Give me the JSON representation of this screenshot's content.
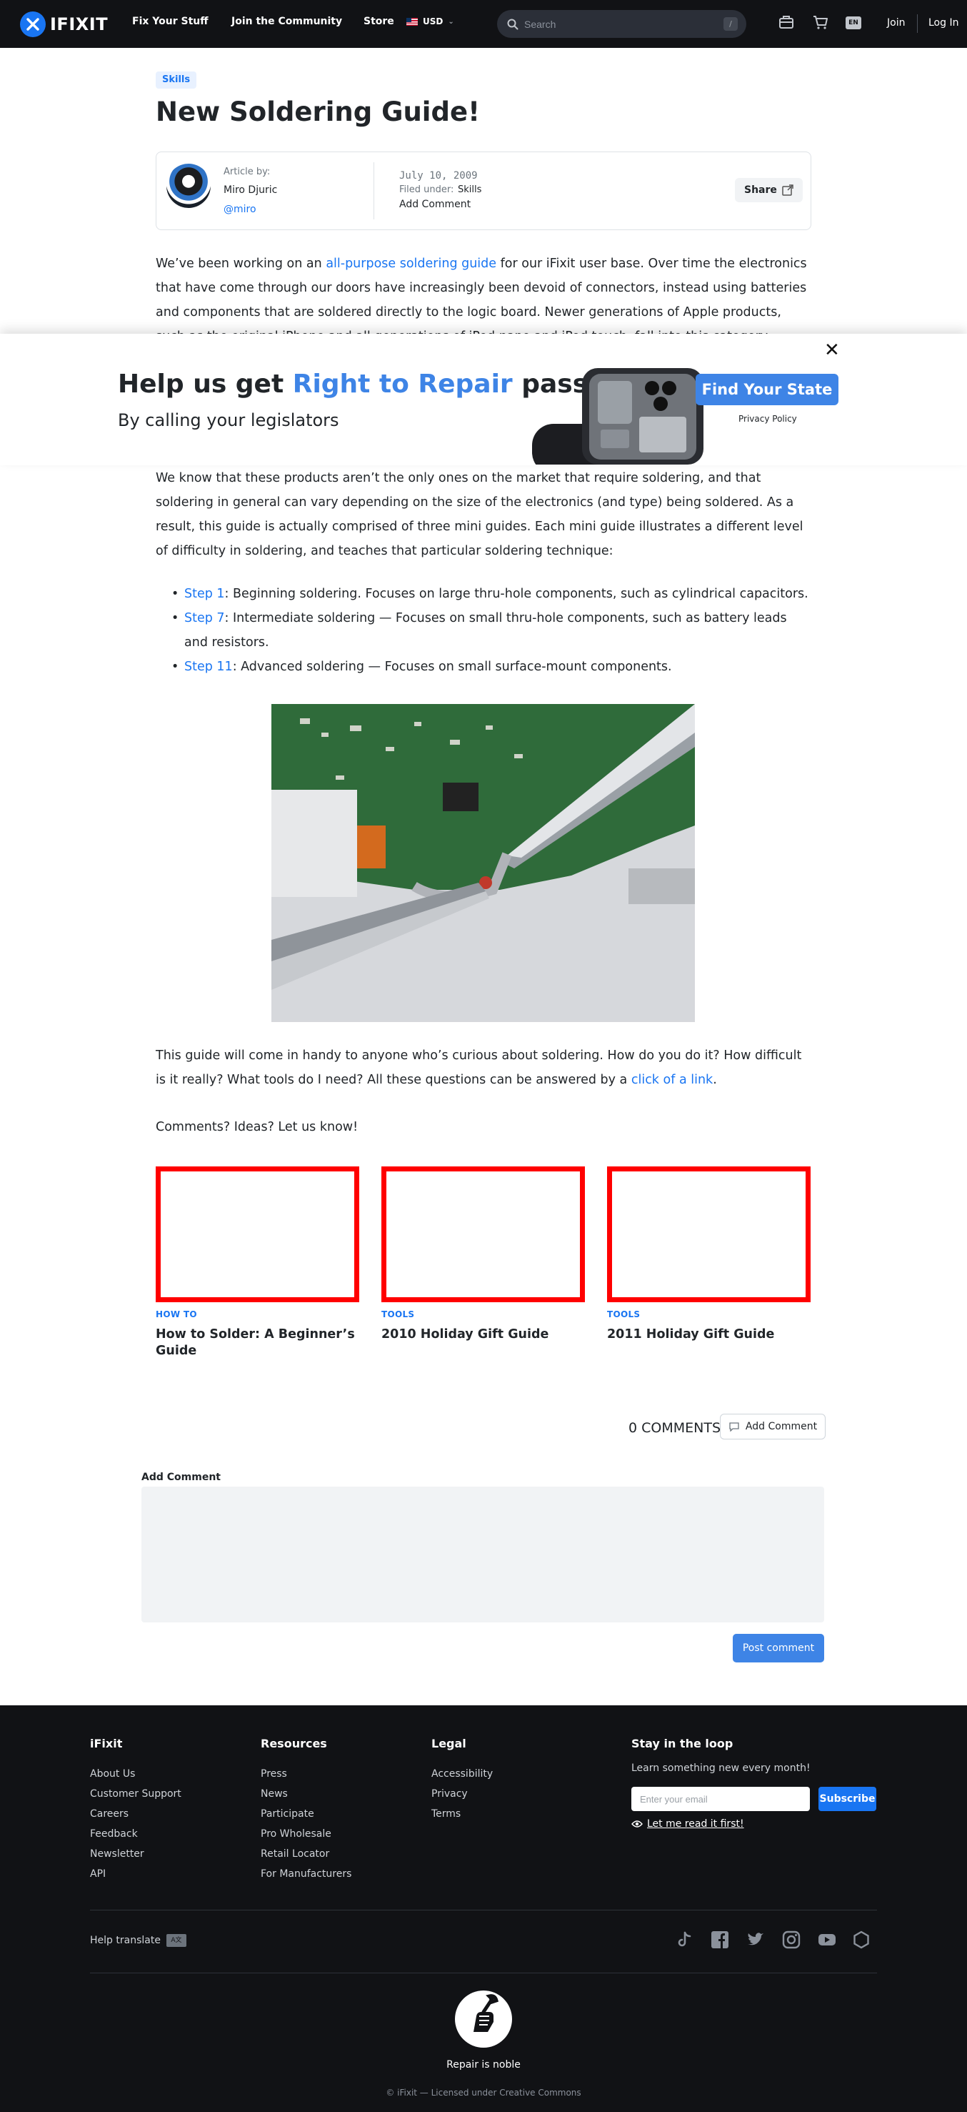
{
  "header": {
    "logo_text": "IFIXIT",
    "nav": [
      "Fix Your Stuff",
      "Join the Community",
      "Store"
    ],
    "currency": "USD",
    "search_placeholder": "Search",
    "search_shortcut": "/",
    "language_badge": "EN",
    "join": "Join",
    "login": "Log In"
  },
  "article": {
    "tag": "Skills",
    "title": "New Soldering Guide!",
    "author_label": "Article by:",
    "author_name": "Miro Djuric",
    "author_handle": "@miro",
    "date": "July 10, 2009",
    "filed_label": "Filed under:",
    "filed_value": "Skills",
    "add_comment": "Add Comment",
    "share": "Share",
    "intro_pre": "We’ve been working on an ",
    "intro_link": "all-purpose soldering guide",
    "intro_post": " for our iFixit user base. Over time the electronics that have come through our doors have increasingly been devoid of connectors, instead using batteries and components that are soldered directly to the logic board. Newer generations of Apple products, such as the original iPhone and all generations of iPod nano and iPod touch, fall into this category.",
    "para2": "We know that these products aren’t the only ones on the market that require soldering, and that soldering in general can vary depending on the size of the electronics (and type) being soldered. As a result, this guide is actually comprised of three mini guides. Each mini guide illustrates a different level of difficulty in soldering, and teaches that particular soldering technique:",
    "steps": [
      {
        "link": "Step 1",
        "text": ": Beginning soldering. Focuses on large thru-hole components, such as cylindrical capacitors."
      },
      {
        "link": "Step 7",
        "text": ": Intermediate soldering — Focuses on small thru-hole components, such as battery leads and resistors."
      },
      {
        "link": "Step 11",
        "text": ": Advanced soldering — Focuses on small surface-mount components."
      }
    ],
    "para3_pre": "This guide will come in handy to anyone who’s curious about soldering. How do you do it? How difficult is it really? What tools do I need? All these questions can be answered by a ",
    "para3_link": "click of a link",
    "para3_post": ".",
    "para4": "Comments? Ideas? Let us know!"
  },
  "banner": {
    "title_pre": "Help us get ",
    "title_highlight": "Right to Repair",
    "title_post": " passed",
    "subtitle": "By calling your legislators",
    "cta": "Find Your State",
    "privacy": "Privacy Policy",
    "close": "✕"
  },
  "related": [
    {
      "kicker": "HOW TO",
      "title": "How to Solder: A Beginner’s Guide"
    },
    {
      "kicker": "TOOLS",
      "title": "2010 Holiday Gift Guide"
    },
    {
      "kicker": "TOOLS",
      "title": "2011 Holiday Gift Guide"
    }
  ],
  "comments": {
    "count": "0 COMMENTS",
    "add_button": "Add Comment",
    "label": "Add Comment",
    "post": "Post comment"
  },
  "footer": {
    "col1": {
      "title": "iFixit",
      "links": [
        "About Us",
        "Customer Support",
        "Careers",
        "Feedback",
        "Newsletter",
        "API"
      ]
    },
    "col2": {
      "title": "Resources",
      "links": [
        "Press",
        "News",
        "Participate",
        "Pro Wholesale",
        "Retail Locator",
        "For Manufacturers"
      ]
    },
    "col3": {
      "title": "Legal",
      "links": [
        "Accessibility",
        "Privacy",
        "Terms"
      ]
    },
    "newsletter": {
      "title": "Stay in the loop",
      "text": "Learn something new every month!",
      "placeholder": "Enter your email",
      "subscribe": "Subscribe",
      "read_first": "Let me read it first!"
    },
    "help_translate": "Help translate",
    "slogan": "Repair is noble",
    "copyright": "© iFixit — Licensed under Creative Commons"
  },
  "colors": {
    "accent": "#1975f2",
    "banner_accent": "#3e84e6",
    "header_bg": "#111215",
    "card_border": "#ff0000"
  }
}
